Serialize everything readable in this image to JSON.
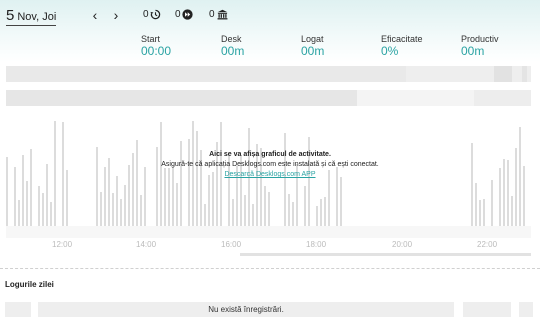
{
  "header": {
    "date_day": "5",
    "date_rest": "Nov, Joi",
    "prev_label": "‹",
    "next_label": "›",
    "counters": [
      {
        "icon": "history-icon",
        "value": "0"
      },
      {
        "icon": "fast-forward-icon",
        "value": "0"
      },
      {
        "icon": "bank-icon",
        "value": "0"
      }
    ]
  },
  "stats": [
    {
      "label": "Start",
      "value": "00:00"
    },
    {
      "label": "Desk",
      "value": "00m"
    },
    {
      "label": "Logat",
      "value": "00m"
    },
    {
      "label": "Eficacitate",
      "value": "0%"
    },
    {
      "label": "Productiv",
      "value": "00m"
    }
  ],
  "chart": {
    "empty_title": "Aici se va afișa graficul de activitate.",
    "empty_text": "Asigură-te că aplicația Desklogs.com este instalată și că ești conectat.",
    "download_link": "Descarcă Desklogs.com APP",
    "ticks": [
      "12:00",
      "14:00",
      "16:00",
      "18:00",
      "20:00",
      "22:00"
    ]
  },
  "logs": {
    "title": "Logurile zilei",
    "empty_message": "Nu există înregistrări."
  },
  "colors": {
    "accent": "#2aa3a3"
  }
}
